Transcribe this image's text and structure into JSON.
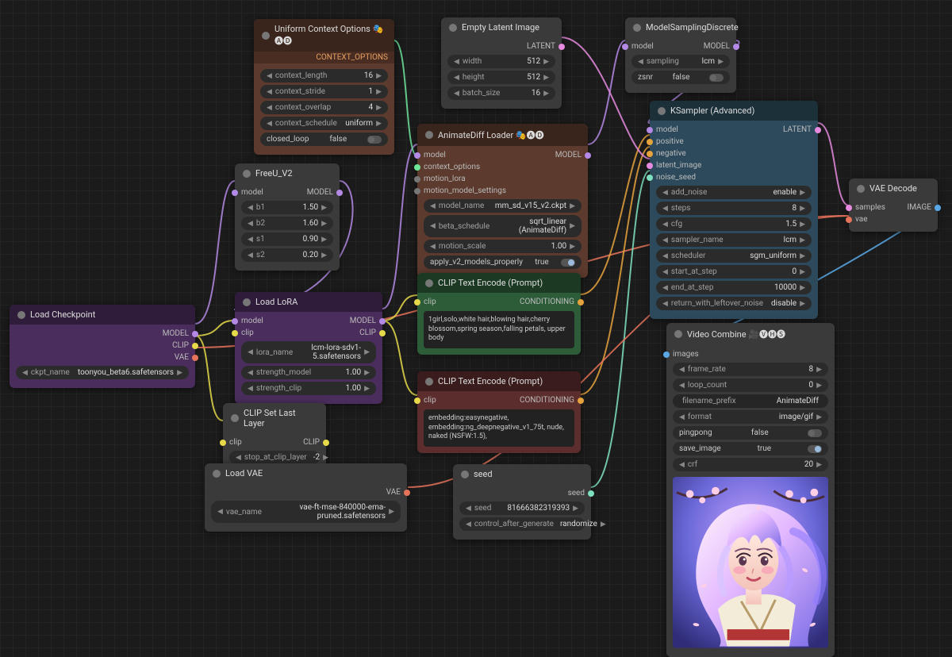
{
  "nodes": {
    "loadCheckpoint": {
      "title": "Load Checkpoint",
      "outputs": [
        "MODEL",
        "CLIP",
        "VAE"
      ],
      "widgets": [
        {
          "label": "ckpt_name",
          "value": "toonyou_beta6.safetensors"
        }
      ]
    },
    "uniformContext": {
      "title": "Uniform Context Options 🎭🅐🅓",
      "subheader": "CONTEXT_OPTIONS",
      "widgets": [
        {
          "label": "context_length",
          "value": "16"
        },
        {
          "label": "context_stride",
          "value": "1"
        },
        {
          "label": "context_overlap",
          "value": "4"
        },
        {
          "label": "context_schedule",
          "value": "uniform"
        }
      ],
      "toggle": {
        "label": "closed_loop",
        "value": "false"
      }
    },
    "freeU": {
      "title": "FreeU_V2",
      "inputs": [
        "model"
      ],
      "outputHdr": "MODEL",
      "widgets": [
        {
          "label": "b1",
          "value": "1.50"
        },
        {
          "label": "b2",
          "value": "1.60"
        },
        {
          "label": "s1",
          "value": "0.90"
        },
        {
          "label": "s2",
          "value": "0.20"
        }
      ]
    },
    "loadLora": {
      "title": "Load LoRA",
      "inputs": [
        "model",
        "clip"
      ],
      "outputs": [
        "MODEL",
        "CLIP"
      ],
      "widgets": [
        {
          "label": "lora_name",
          "value": "lcm-lora-sdv1-5.safetensors"
        },
        {
          "label": "strength_model",
          "value": "1.00"
        },
        {
          "label": "strength_clip",
          "value": "1.00"
        }
      ]
    },
    "clipSet": {
      "title": "CLIP Set Last Layer",
      "inputs": [
        "clip"
      ],
      "outputHdr": "CLIP",
      "widgets": [
        {
          "label": "stop_at_clip_layer",
          "value": "-2"
        }
      ]
    },
    "loadVae": {
      "title": "Load VAE",
      "outputHdr": "VAE",
      "widgets": [
        {
          "label": "vae_name",
          "value": "vae-ft-mse-840000-ema-pruned.safetensors"
        }
      ]
    },
    "emptyLatent": {
      "title": "Empty Latent Image",
      "outputHdr": "LATENT",
      "widgets": [
        {
          "label": "width",
          "value": "512"
        },
        {
          "label": "height",
          "value": "512"
        },
        {
          "label": "batch_size",
          "value": "16"
        }
      ]
    },
    "animatediff": {
      "title": "AnimateDiff Loader 🎭🅐🅓",
      "inputs": [
        "model",
        "context_options",
        "motion_lora",
        "motion_model_settings"
      ],
      "outputHdr": "MODEL",
      "widgets": [
        {
          "label": "model_name",
          "value": "mm_sd_v15_v2.ckpt"
        },
        {
          "label": "beta_schedule",
          "value": "sqrt_linear (AnimateDiff)"
        },
        {
          "label": "motion_scale",
          "value": "1.00"
        }
      ],
      "toggle": {
        "label": "apply_v2_models_properly",
        "value": "true"
      }
    },
    "clipPos": {
      "title": "CLIP Text Encode (Prompt)",
      "inputs": [
        "clip"
      ],
      "outputHdr": "CONDITIONING",
      "text": "1girl,solo,white hair,blowing hair,cherry blossom,spring season,falling petals, upper body"
    },
    "clipNeg": {
      "title": "CLIP Text Encode (Prompt)",
      "inputs": [
        "clip"
      ],
      "outputHdr": "CONDITIONING",
      "text": "embedding:easynegative, embedding:ng_deepnegative_v1_75t, nude, naked (NSFW:1.5),"
    },
    "seed": {
      "title": "seed",
      "outputHdr": "seed",
      "widgets": [
        {
          "label": "seed",
          "value": "81666382319393"
        },
        {
          "label": "control_after_generate",
          "value": "randomize"
        }
      ]
    },
    "modelSampling": {
      "title": "ModelSamplingDiscrete",
      "inputs": [
        "model"
      ],
      "outputHdr": "MODEL",
      "widgets": [
        {
          "label": "sampling",
          "value": "lcm"
        }
      ],
      "toggle": {
        "label": "zsnr",
        "value": "false"
      }
    },
    "ksampler": {
      "title": "KSampler (Advanced)",
      "inputs": [
        "model",
        "positive",
        "negative",
        "latent_image",
        "noise_seed"
      ],
      "outputHdr": "LATENT",
      "widgets": [
        {
          "label": "add_noise",
          "value": "enable"
        },
        {
          "label": "steps",
          "value": "8"
        },
        {
          "label": "cfg",
          "value": "1.5"
        },
        {
          "label": "sampler_name",
          "value": "lcm"
        },
        {
          "label": "scheduler",
          "value": "sgm_uniform"
        },
        {
          "label": "start_at_step",
          "value": "0"
        },
        {
          "label": "end_at_step",
          "value": "10000"
        },
        {
          "label": "return_with_leftover_noise",
          "value": "disable"
        }
      ]
    },
    "vaeDecode": {
      "title": "VAE Decode",
      "inputs": [
        "samples",
        "vae"
      ],
      "outputHdr": "IMAGE"
    },
    "videoCombine": {
      "title": "Video Combine 🎥🅥🅗🅢",
      "inputs": [
        "images"
      ],
      "widgets": [
        {
          "label": "frame_rate",
          "value": "8"
        },
        {
          "label": "loop_count",
          "value": "0"
        },
        {
          "label": "filename_prefix",
          "value": "AnimateDiff"
        },
        {
          "label": "format",
          "value": "image/gif"
        }
      ],
      "toggleA": {
        "label": "pingpong",
        "value": "false"
      },
      "toggleB": {
        "label": "save_image",
        "value": "true"
      },
      "widgets2": [
        {
          "label": "crf",
          "value": "20"
        }
      ]
    }
  },
  "colors": {
    "model": "#b48ae6",
    "clip": "#e6d94a",
    "vae": "#e6735a",
    "latent": "#e68adf",
    "cond": "#e6a23c",
    "image": "#5aa9e6",
    "ctx": "#6de69a",
    "seed": "#6de69a",
    "int": "#7fe0c0"
  }
}
